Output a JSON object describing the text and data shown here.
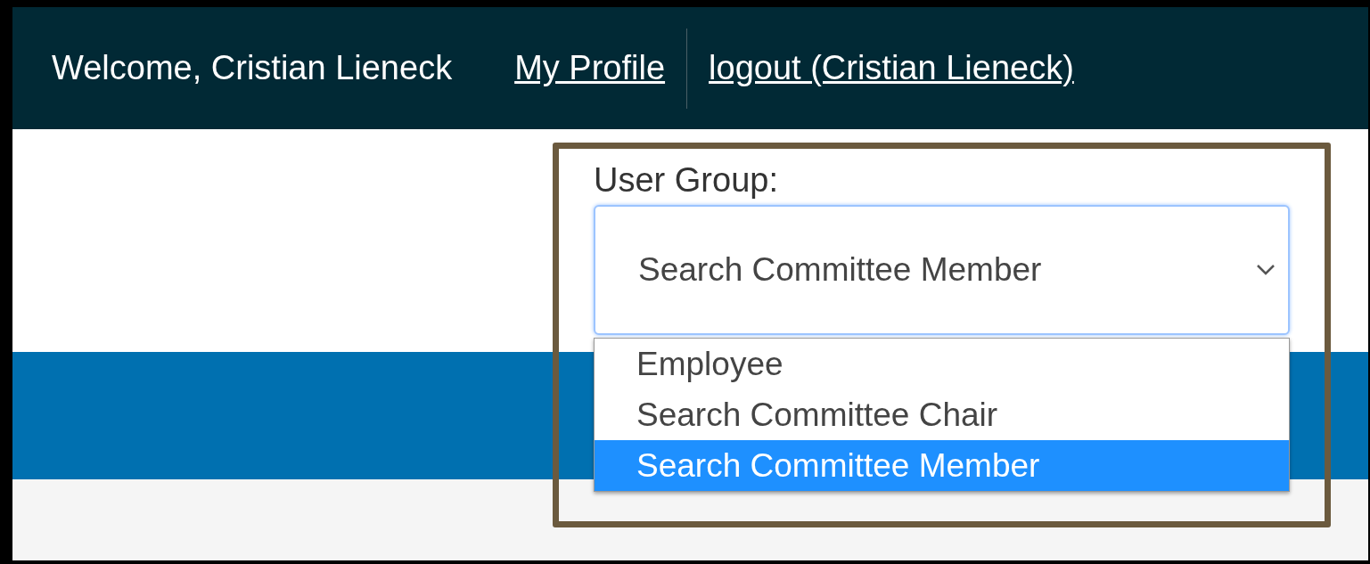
{
  "header": {
    "welcome": "Welcome, Cristian Lieneck",
    "links": [
      {
        "label": "My Profile"
      },
      {
        "label": "logout (Cristian Lieneck)"
      }
    ]
  },
  "user_group": {
    "label": "User Group:",
    "value": "Search Committee Member",
    "expanded": true,
    "options": [
      {
        "label": "Employee",
        "selected": false
      },
      {
        "label": "Search Committee Chair",
        "selected": false
      },
      {
        "label": "Search Committee Member",
        "selected": true
      }
    ]
  }
}
